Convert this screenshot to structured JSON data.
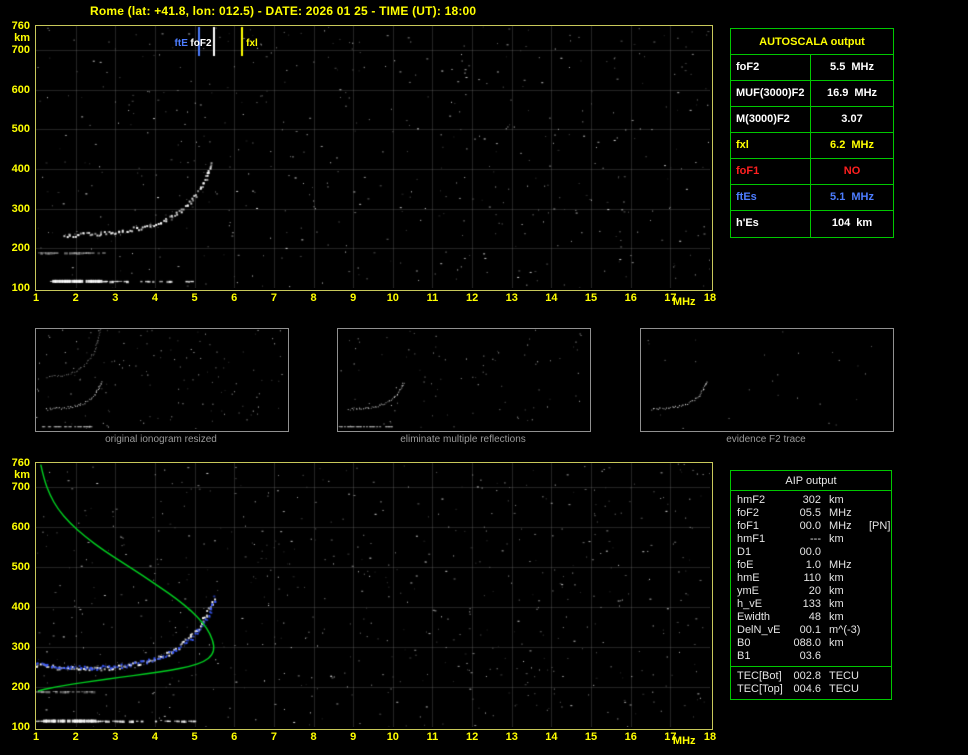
{
  "title": "Rome (lat: +41.8, lon: 012.5) - DATE: 2026 01 25 - TIME (UT): 18:00",
  "colors": {
    "background": "#000000",
    "axis_yellow": "#ffff00",
    "frame_yellow": "#c8c85a",
    "table_green": "#00c800",
    "profile_green": "#00d020",
    "trace_blue": "#3a5aff",
    "alert_red": "#ff2020",
    "caption_gray": "#9a9a9a"
  },
  "autoscala_table": {
    "header": "AUTOSCALA output",
    "rows": [
      {
        "label": "foF2",
        "value": "5.5",
        "unit": "MHz",
        "color": "#ffffff"
      },
      {
        "label": "MUF(3000)F2",
        "value": "16.9",
        "unit": "MHz",
        "color": "#ffffff"
      },
      {
        "label": "M(3000)F2",
        "value": "3.07",
        "unit": "",
        "color": "#ffffff"
      },
      {
        "label": "fxl",
        "value": "6.2",
        "unit": "MHz",
        "color": "#ffff00"
      },
      {
        "label": "foF1",
        "value": "NO",
        "unit": "",
        "color": "#ff2020"
      },
      {
        "label": "ftEs",
        "value": "5.1",
        "unit": "MHz",
        "color": "#4d7dff"
      },
      {
        "label": "h'Es",
        "value": "104",
        "unit": "km",
        "color": "#ffffff"
      }
    ]
  },
  "aip_table": {
    "header": "AIP output",
    "rows": [
      {
        "label": "hmF2",
        "value": "302",
        "unit": "km",
        "note": ""
      },
      {
        "label": "foF2",
        "value": "05.5",
        "unit": "MHz",
        "note": ""
      },
      {
        "label": "foF1",
        "value": "00.0",
        "unit": "MHz",
        "note": "[PN]"
      },
      {
        "label": "hmF1",
        "value": "---",
        "unit": "km",
        "note": ""
      },
      {
        "label": "D1",
        "value": "00.0",
        "unit": "",
        "note": ""
      },
      {
        "label": "foE",
        "value": "1.0",
        "unit": "MHz",
        "note": ""
      },
      {
        "label": "hmE",
        "value": "110",
        "unit": "km",
        "note": ""
      },
      {
        "label": "ymE",
        "value": "20",
        "unit": "km",
        "note": ""
      },
      {
        "label": "h_vE",
        "value": "133",
        "unit": "km",
        "note": ""
      },
      {
        "label": "Ewidth",
        "value": "48",
        "unit": "km",
        "note": ""
      },
      {
        "label": "DelN_vE",
        "value": "00.1",
        "unit": "m^(-3)",
        "note": ""
      },
      {
        "label": "B0",
        "value": "088.0",
        "unit": "km",
        "note": ""
      },
      {
        "label": "B1",
        "value": "03.6",
        "unit": "",
        "note": ""
      },
      {
        "label": "TEC[Bot]",
        "value": "002.8",
        "unit": "TECU",
        "note": "",
        "sep_before": true
      },
      {
        "label": "TEC[Top]",
        "value": "004.6",
        "unit": "TECU",
        "note": ""
      }
    ]
  },
  "thumbnails": [
    {
      "caption": "original ionogram resized",
      "noise_count": 130,
      "seed": 901,
      "show_es": true,
      "show_second_hop": true
    },
    {
      "caption": "eliminate multiple reflections",
      "noise_count": 85,
      "seed": 902,
      "show_es": true,
      "show_second_hop": false
    },
    {
      "caption": "evidence F2 trace",
      "noise_count": 25,
      "seed": 903,
      "show_es": false,
      "show_second_hop": false
    }
  ],
  "chart_data": [
    {
      "id": "top_ionogram",
      "type": "scatter",
      "title": "raw ionogram with autoscaled characteristic frequencies",
      "xlabel": "MHz",
      "ylabel": "km",
      "xlim": [
        1,
        18
      ],
      "ylim": [
        100,
        760
      ],
      "xticks": [
        1,
        2,
        3,
        4,
        5,
        6,
        7,
        8,
        9,
        10,
        11,
        12,
        13,
        14,
        15,
        16,
        17,
        18
      ],
      "yticks": [
        760,
        700,
        600,
        500,
        400,
        300,
        200,
        100
      ],
      "grid": true,
      "grid_x": [
        2,
        3,
        4,
        5,
        6,
        7,
        8,
        9,
        10,
        11,
        12,
        13,
        14,
        15,
        16,
        17
      ],
      "grid_y": [
        200,
        300,
        400,
        500,
        600,
        700
      ],
      "noise": {
        "seed": 20260125,
        "count": 520
      },
      "markers": [
        {
          "label": "ftE",
          "x_mhz": 5.1,
          "color": "#4d7dff",
          "label_pos": "left"
        },
        {
          "label": "foF2",
          "x_mhz": 5.5,
          "color": "#ffffff",
          "label_pos": "left"
        },
        {
          "label": "fxl",
          "x_mhz": 6.2,
          "color": "#ffff00",
          "label_pos": "right"
        }
      ],
      "series": [
        {
          "name": "F2 trace echoes",
          "style": "dots",
          "color": "#ffffff",
          "size": 2,
          "points": [
            [
              1.7,
              232
            ],
            [
              2.0,
              236
            ],
            [
              2.4,
              238
            ],
            [
              2.8,
              241
            ],
            [
              3.2,
              246
            ],
            [
              3.6,
              253
            ],
            [
              3.95,
              262
            ],
            [
              4.25,
              274
            ],
            [
              4.5,
              288
            ],
            [
              4.75,
              306
            ],
            [
              4.95,
              326
            ],
            [
              5.1,
              348
            ],
            [
              5.22,
              370
            ],
            [
              5.32,
              390
            ],
            [
              5.4,
              405
            ],
            [
              5.45,
              418
            ]
          ]
        },
        {
          "name": "Es layer echoes",
          "style": "dashes",
          "color": "#ffffff",
          "y_km": 118,
          "x_range": [
            1.05,
            4.9
          ],
          "bold_range": [
            1.4,
            2.6
          ],
          "alpha": 1,
          "reported_h_Es_km": 104
        },
        {
          "name": "Es second reflection",
          "style": "dashes",
          "color": "#ffffff",
          "y_km": 190,
          "x_range": [
            1.05,
            2.7
          ],
          "bold_range": [
            0,
            0
          ],
          "alpha": 0.55
        }
      ]
    },
    {
      "id": "bottom_ionogram_profile",
      "type": "scatter",
      "title": "cleaned ionogram with restored trace and electron density profile",
      "xlabel": "MHz",
      "ylabel": "km",
      "xlim": [
        1,
        18
      ],
      "ylim": [
        100,
        760
      ],
      "xticks": [
        1,
        2,
        3,
        4,
        5,
        6,
        7,
        8,
        9,
        10,
        11,
        12,
        13,
        14,
        15,
        16,
        17,
        18
      ],
      "yticks": [
        760,
        700,
        600,
        500,
        400,
        300,
        200,
        100
      ],
      "grid": true,
      "grid_x": [
        2,
        3,
        4,
        5,
        6,
        7,
        8,
        9,
        10,
        11,
        12,
        13,
        14,
        15,
        16,
        17
      ],
      "grid_y": [
        200,
        300,
        400,
        500,
        600,
        700
      ],
      "noise": {
        "seed": 777001,
        "count": 620
      },
      "markers": [],
      "series": [
        {
          "name": "F2 trace echoes",
          "style": "dots",
          "color": "#ffffff",
          "size": 2,
          "points": [
            [
              1.0,
              256
            ],
            [
              1.3,
              252
            ],
            [
              1.7,
              249
            ],
            [
              2.1,
              247
            ],
            [
              2.5,
              247
            ],
            [
              2.9,
              250
            ],
            [
              3.3,
              255
            ],
            [
              3.7,
              263
            ],
            [
              4.05,
              274
            ],
            [
              4.35,
              288
            ],
            [
              4.6,
              304
            ],
            [
              4.85,
              324
            ],
            [
              5.05,
              346
            ],
            [
              5.2,
              368
            ],
            [
              5.32,
              390
            ],
            [
              5.42,
              410
            ],
            [
              5.47,
              424
            ]
          ]
        },
        {
          "name": "autoscaled F2 trace",
          "style": "dots",
          "color": "#3a5aff",
          "size": 2,
          "points": [
            [
              1.0,
              259
            ],
            [
              1.4,
              255
            ],
            [
              1.8,
              252
            ],
            [
              2.2,
              250
            ],
            [
              2.6,
              250
            ],
            [
              3.0,
              253
            ],
            [
              3.4,
              258
            ],
            [
              3.8,
              266
            ],
            [
              4.15,
              277
            ],
            [
              4.45,
              291
            ],
            [
              4.7,
              307
            ],
            [
              4.95,
              328
            ],
            [
              5.15,
              350
            ],
            [
              5.3,
              372
            ],
            [
              5.4,
              394
            ],
            [
              5.47,
              414
            ],
            [
              5.5,
              430
            ]
          ]
        },
        {
          "name": "electron density profile N(h)",
          "style": "line",
          "color": "#00d020",
          "points": [
            [
              1.12,
              756
            ],
            [
              1.2,
              720
            ],
            [
              1.35,
              680
            ],
            [
              1.55,
              645
            ],
            [
              1.85,
              610
            ],
            [
              2.25,
              575
            ],
            [
              2.7,
              542
            ],
            [
              3.2,
              510
            ],
            [
              3.7,
              478
            ],
            [
              4.15,
              448
            ],
            [
              4.55,
              420
            ],
            [
              4.9,
              392
            ],
            [
              5.2,
              362
            ],
            [
              5.4,
              332
            ],
            [
              5.5,
              302
            ],
            [
              5.45,
              280
            ],
            [
              5.25,
              264
            ],
            [
              4.9,
              252
            ],
            [
              4.4,
              242
            ],
            [
              3.8,
              233
            ],
            [
              3.1,
              224
            ],
            [
              2.45,
              215
            ],
            [
              1.9,
              207
            ],
            [
              1.5,
              200
            ],
            [
              1.2,
              194
            ],
            [
              1.05,
              190
            ]
          ]
        },
        {
          "name": "Es layer echoes",
          "style": "dashes",
          "color": "#ffffff",
          "y_km": 116,
          "x_range": [
            1.0,
            5.0
          ],
          "bold_range": [
            1.15,
            2.5
          ],
          "alpha": 1
        },
        {
          "name": "Es second reflection",
          "style": "dashes",
          "color": "#ffffff",
          "y_km": 190,
          "x_range": [
            1.0,
            2.4
          ],
          "bold_range": [
            0,
            0
          ],
          "alpha": 0.5
        }
      ]
    }
  ]
}
